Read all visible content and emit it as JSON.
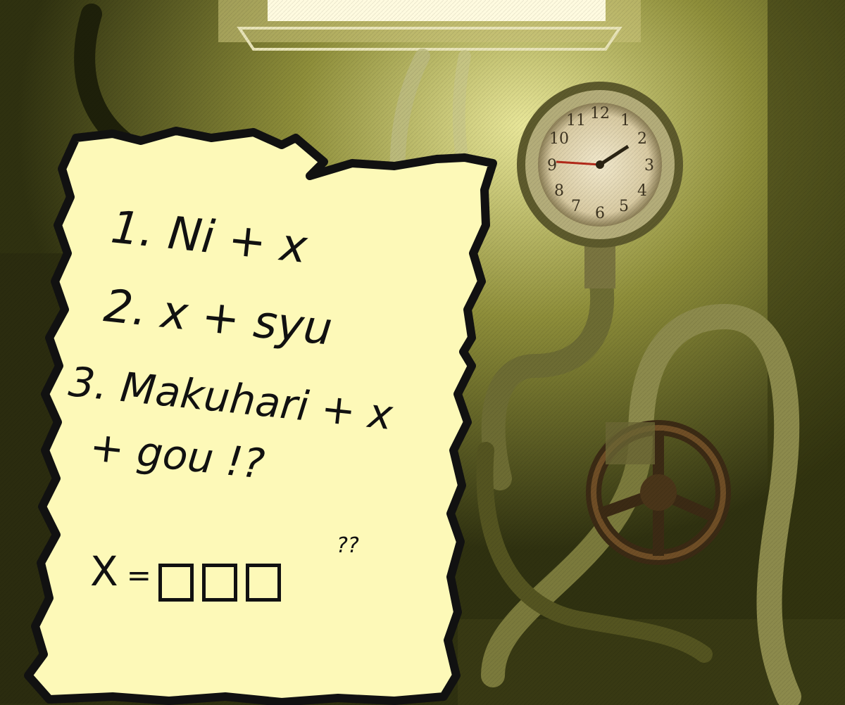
{
  "scene": {
    "colors": {
      "background": "#4b4c1e",
      "paper": "#fdf9b8",
      "ink": "#111111",
      "gauge_face": "#e6dcc0",
      "light": "#fffbe0"
    },
    "icons": [
      "clock-icon",
      "valve-wheel-icon",
      "pipe-icon",
      "ceiling-light-icon"
    ]
  },
  "note": {
    "lines": [
      "1. Ni + x",
      "2. x + syu",
      "3. Makuhari + x",
      "+ gou !?"
    ],
    "answer": {
      "label": "X",
      "equals": "=",
      "slots": 3,
      "hint": "??"
    }
  }
}
